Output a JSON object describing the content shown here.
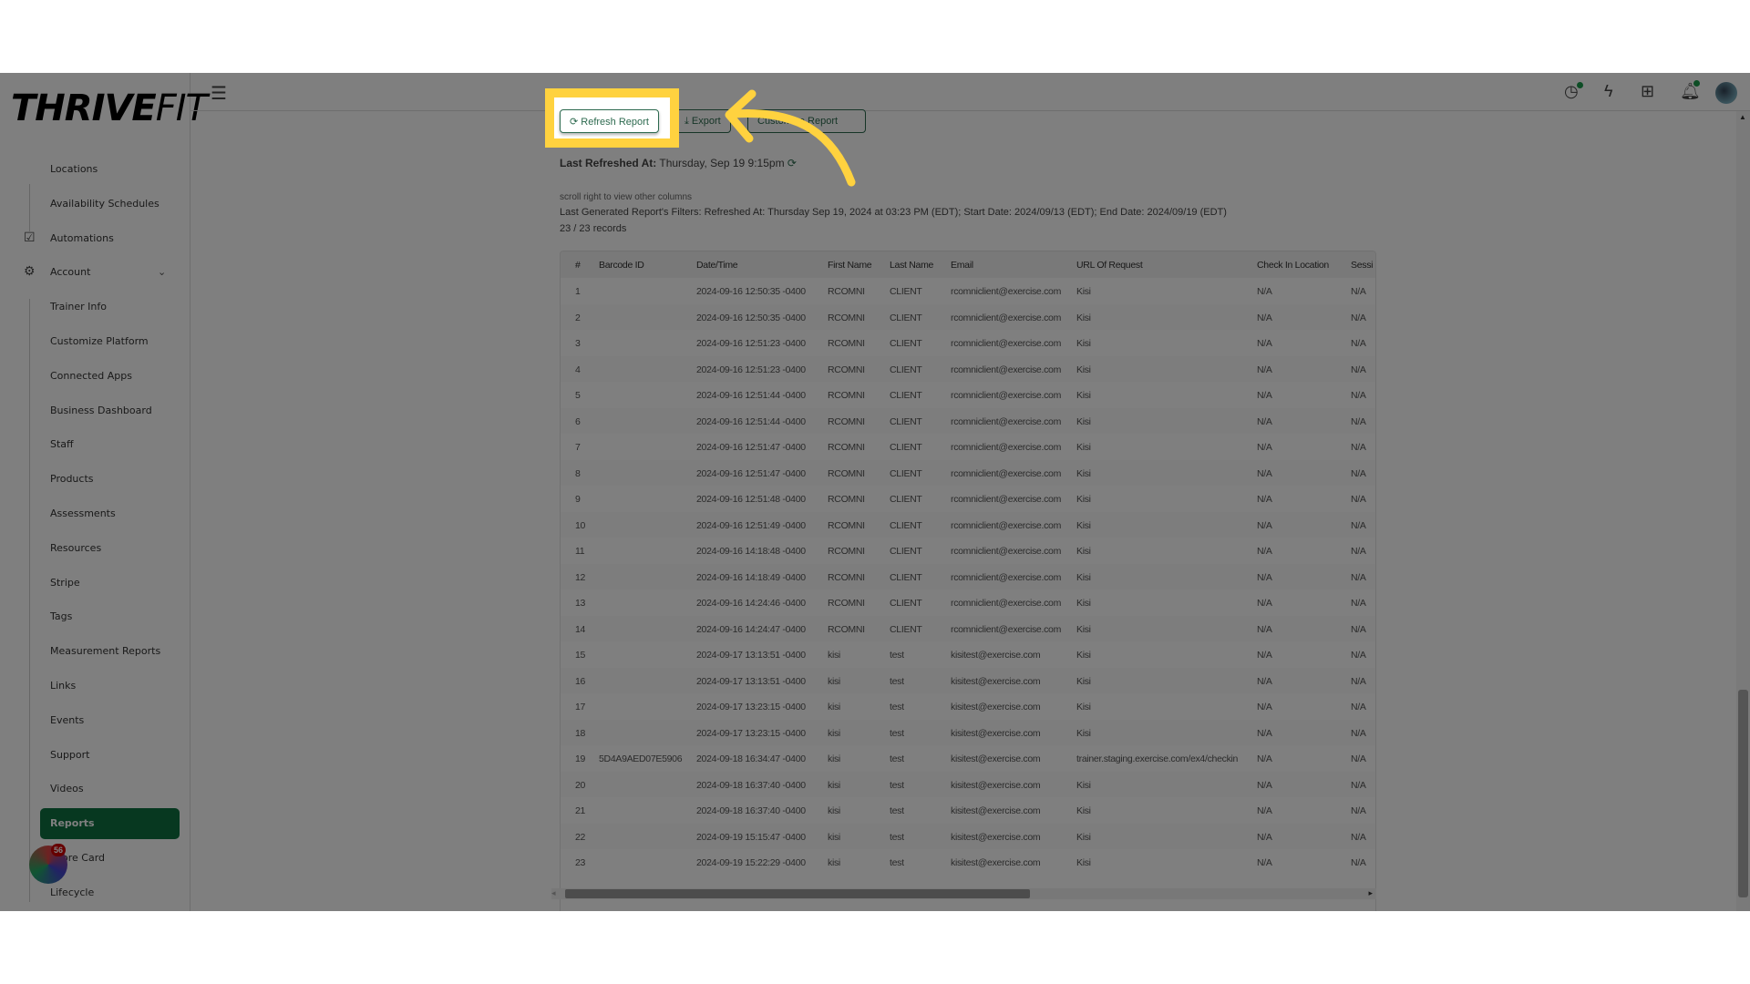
{
  "brand": {
    "bold": "THRIVE",
    "light": "FIT"
  },
  "sidebar": {
    "items": [
      {
        "label": "Locations"
      },
      {
        "label": "Availability Schedules"
      },
      {
        "label": "Automations",
        "icon": "checkbox-icon"
      },
      {
        "label": "Account",
        "icon": "gear-icon"
      },
      {
        "label": "Trainer Info"
      },
      {
        "label": "Customize Platform"
      },
      {
        "label": "Connected Apps"
      },
      {
        "label": "Business Dashboard"
      },
      {
        "label": "Staff"
      },
      {
        "label": "Products"
      },
      {
        "label": "Assessments"
      },
      {
        "label": "Resources"
      },
      {
        "label": "Stripe"
      },
      {
        "label": "Tags"
      },
      {
        "label": "Measurement Reports"
      },
      {
        "label": "Links"
      },
      {
        "label": "Events"
      },
      {
        "label": "Support"
      },
      {
        "label": "Videos"
      },
      {
        "label": "Reports",
        "active": true
      },
      {
        "label": "Score Card"
      },
      {
        "label": "Lifecycle"
      }
    ],
    "chat_badge": "56"
  },
  "toolbar": {
    "refresh": "Refresh Report",
    "export": "Export",
    "customize": "Customize Report"
  },
  "report": {
    "last_refreshed_label": "Last Refreshed At:",
    "last_refreshed_value": "Thursday, Sep 19 9:15pm",
    "scroll_hint": "scroll right to view other columns",
    "filters": "Last Generated Report's Filters: Refreshed At: Thursday Sep 19, 2024 at 03:23 PM (EDT); Start Date: 2024/09/13 (EDT); End Date: 2024/09/19 (EDT)",
    "records": "23 / 23 records"
  },
  "table": {
    "columns": [
      "#",
      "Barcode ID",
      "Date/Time",
      "First Name",
      "Last Name",
      "Email",
      "URL Of Request",
      "Check In Location",
      "Sessi"
    ],
    "rows": [
      [
        "1",
        "",
        "2024-09-16 12:50:35 -0400",
        "RCOMNI",
        "CLIENT",
        "rcomniclient@exercise.com",
        "Kisi",
        "N/A",
        "N/A"
      ],
      [
        "2",
        "",
        "2024-09-16 12:50:35 -0400",
        "RCOMNI",
        "CLIENT",
        "rcomniclient@exercise.com",
        "Kisi",
        "N/A",
        "N/A"
      ],
      [
        "3",
        "",
        "2024-09-16 12:51:23 -0400",
        "RCOMNI",
        "CLIENT",
        "rcomniclient@exercise.com",
        "Kisi",
        "N/A",
        "N/A"
      ],
      [
        "4",
        "",
        "2024-09-16 12:51:23 -0400",
        "RCOMNI",
        "CLIENT",
        "rcomniclient@exercise.com",
        "Kisi",
        "N/A",
        "N/A"
      ],
      [
        "5",
        "",
        "2024-09-16 12:51:44 -0400",
        "RCOMNI",
        "CLIENT",
        "rcomniclient@exercise.com",
        "Kisi",
        "N/A",
        "N/A"
      ],
      [
        "6",
        "",
        "2024-09-16 12:51:44 -0400",
        "RCOMNI",
        "CLIENT",
        "rcomniclient@exercise.com",
        "Kisi",
        "N/A",
        "N/A"
      ],
      [
        "7",
        "",
        "2024-09-16 12:51:47 -0400",
        "RCOMNI",
        "CLIENT",
        "rcomniclient@exercise.com",
        "Kisi",
        "N/A",
        "N/A"
      ],
      [
        "8",
        "",
        "2024-09-16 12:51:47 -0400",
        "RCOMNI",
        "CLIENT",
        "rcomniclient@exercise.com",
        "Kisi",
        "N/A",
        "N/A"
      ],
      [
        "9",
        "",
        "2024-09-16 12:51:48 -0400",
        "RCOMNI",
        "CLIENT",
        "rcomniclient@exercise.com",
        "Kisi",
        "N/A",
        "N/A"
      ],
      [
        "10",
        "",
        "2024-09-16 12:51:49 -0400",
        "RCOMNI",
        "CLIENT",
        "rcomniclient@exercise.com",
        "Kisi",
        "N/A",
        "N/A"
      ],
      [
        "11",
        "",
        "2024-09-16 14:18:48 -0400",
        "RCOMNI",
        "CLIENT",
        "rcomniclient@exercise.com",
        "Kisi",
        "N/A",
        "N/A"
      ],
      [
        "12",
        "",
        "2024-09-16 14:18:49 -0400",
        "RCOMNI",
        "CLIENT",
        "rcomniclient@exercise.com",
        "Kisi",
        "N/A",
        "N/A"
      ],
      [
        "13",
        "",
        "2024-09-16 14:24:46 -0400",
        "RCOMNI",
        "CLIENT",
        "rcomniclient@exercise.com",
        "Kisi",
        "N/A",
        "N/A"
      ],
      [
        "14",
        "",
        "2024-09-16 14:24:47 -0400",
        "RCOMNI",
        "CLIENT",
        "rcomniclient@exercise.com",
        "Kisi",
        "N/A",
        "N/A"
      ],
      [
        "15",
        "",
        "2024-09-17 13:13:51 -0400",
        "kisi",
        "test",
        "kisitest@exercise.com",
        "Kisi",
        "N/A",
        "N/A"
      ],
      [
        "16",
        "",
        "2024-09-17 13:13:51 -0400",
        "kisi",
        "test",
        "kisitest@exercise.com",
        "Kisi",
        "N/A",
        "N/A"
      ],
      [
        "17",
        "",
        "2024-09-17 13:23:15 -0400",
        "kisi",
        "test",
        "kisitest@exercise.com",
        "Kisi",
        "N/A",
        "N/A"
      ],
      [
        "18",
        "",
        "2024-09-17 13:23:15 -0400",
        "kisi",
        "test",
        "kisitest@exercise.com",
        "Kisi",
        "N/A",
        "N/A"
      ],
      [
        "19",
        "5D4A9AED07E5906",
        "2024-09-18 16:34:47 -0400",
        "kisi",
        "test",
        "kisitest@exercise.com",
        "trainer.staging.exercise.com/ex4/checkin",
        "N/A",
        "N/A"
      ],
      [
        "20",
        "",
        "2024-09-18 16:37:40 -0400",
        "kisi",
        "test",
        "kisitest@exercise.com",
        "Kisi",
        "N/A",
        "N/A"
      ],
      [
        "21",
        "",
        "2024-09-18 16:37:40 -0400",
        "kisi",
        "test",
        "kisitest@exercise.com",
        "Kisi",
        "N/A",
        "N/A"
      ],
      [
        "22",
        "",
        "2024-09-19 15:15:47 -0400",
        "kisi",
        "test",
        "kisitest@exercise.com",
        "Kisi",
        "N/A",
        "N/A"
      ],
      [
        "23",
        "",
        "2024-09-19 15:22:29 -0400",
        "kisi",
        "test",
        "kisitest@exercise.com",
        "Kisi",
        "N/A",
        "N/A"
      ]
    ]
  },
  "colors": {
    "accent": "#0e7040",
    "highlight": "#ffd23f",
    "overlay": "rgba(0,0,0,0.5)"
  }
}
